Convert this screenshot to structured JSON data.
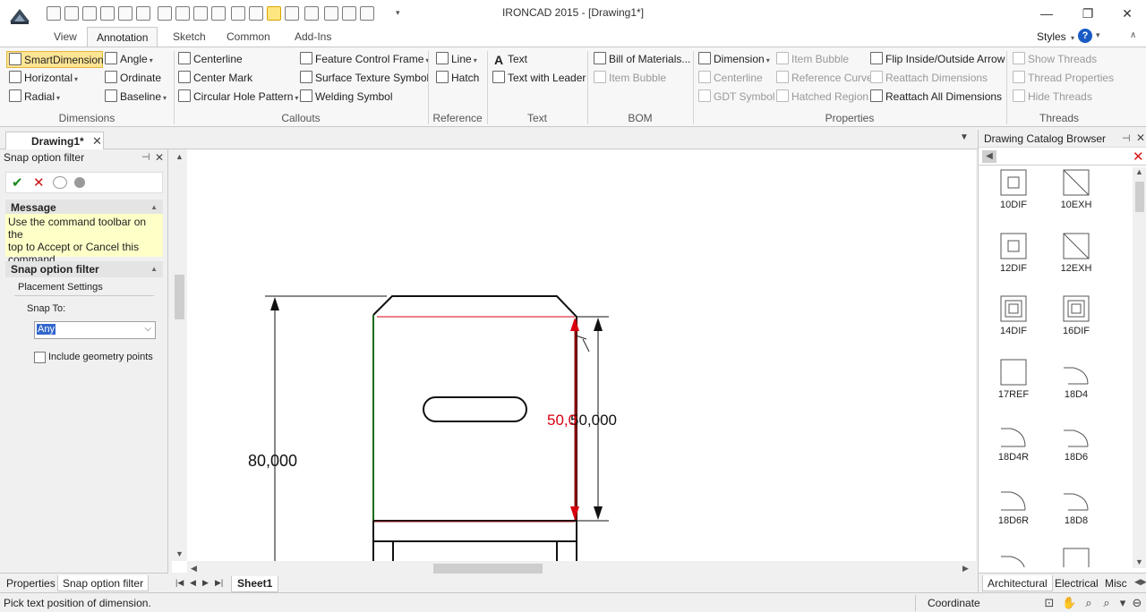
{
  "window": {
    "title": "IRONCAD 2015 - [Drawing1*]",
    "min": "—",
    "max": "❐",
    "close": "✕"
  },
  "ribbon_tabs": [
    "View",
    "Annotation",
    "Sketch",
    "Common",
    "Add-Ins"
  ],
  "styles_label": "Styles",
  "help": "?",
  "groups": {
    "dimensions": {
      "label": "Dimensions",
      "smart": "SmartDimension",
      "horizontal": "Horizontal",
      "radial": "Radial",
      "angle": "Angle",
      "ordinate": "Ordinate",
      "baseline": "Baseline"
    },
    "callouts": {
      "label": "Callouts",
      "centerline": "Centerline",
      "center_mark": "Center Mark",
      "circular_hole": "Circular Hole Pattern",
      "fcf": "Feature Control Frame",
      "surface_texture": "Surface Texture Symbol",
      "welding": "Welding Symbol"
    },
    "reference": {
      "label": "Reference",
      "line": "Line",
      "hatch": "Hatch"
    },
    "text": {
      "label": "Text",
      "text": "Text",
      "leader": "Text with Leader"
    },
    "bom": {
      "label": "BOM",
      "bill": "Bill of Materials...",
      "bubble": "Item Bubble"
    },
    "properties": {
      "label": "Properties",
      "dimension": "Dimension",
      "centerline": "Centerline",
      "gdt": "GDT Symbol",
      "item_bubble": "Item Bubble",
      "ref_curve": "Reference Curve",
      "hatched": "Hatched Region",
      "flip": "Flip Inside/Outside Arrow",
      "reattach": "Reattach Dimensions",
      "reattach_all": "Reattach All Dimensions"
    },
    "threads": {
      "label": "Threads",
      "show": "Show Threads",
      "props": "Thread Properties",
      "hide": "Hide Threads"
    }
  },
  "doc_tab": {
    "label": "Drawing1*",
    "close": "✕"
  },
  "left_panel": {
    "title": "Snap option filter",
    "pin": "⊣",
    "close": "✕",
    "message_head": "Message",
    "message_line1": "Use the command toolbar on the",
    "message_line2": "top to Accept or Cancel this",
    "message_line3": "command.",
    "snap_head": "Snap option filter",
    "placement": "Placement Settings",
    "snap_to": "Snap To:",
    "snap_value": "Any",
    "include_geometry": "Include geometry points"
  },
  "left_bottom_tabs": [
    "Properties",
    "Snap option filter"
  ],
  "sheet_tab": "Sheet1",
  "drawing": {
    "dim_height": "80,000",
    "dim_right_black": "50,000",
    "dim_right_red": "50,0"
  },
  "right_panel": {
    "title": "Drawing Catalog Browser",
    "items": [
      "10DIF",
      "10EXH",
      "12DIF",
      "12EXH",
      "14DIF",
      "16DIF",
      "17REF",
      "18D4",
      "18D4R",
      "18D6",
      "18D6R",
      "18D8"
    ],
    "tabs": [
      "Architectural",
      "Electrical",
      "Misc"
    ]
  },
  "status": {
    "text": "Pick text position of dimension.",
    "coordinate": "Coordinate"
  },
  "colors": {
    "accent": "#fde594",
    "help": "#1a5bc4",
    "dim_red": "#d8000f",
    "green_edge": "#1a6b1a"
  }
}
